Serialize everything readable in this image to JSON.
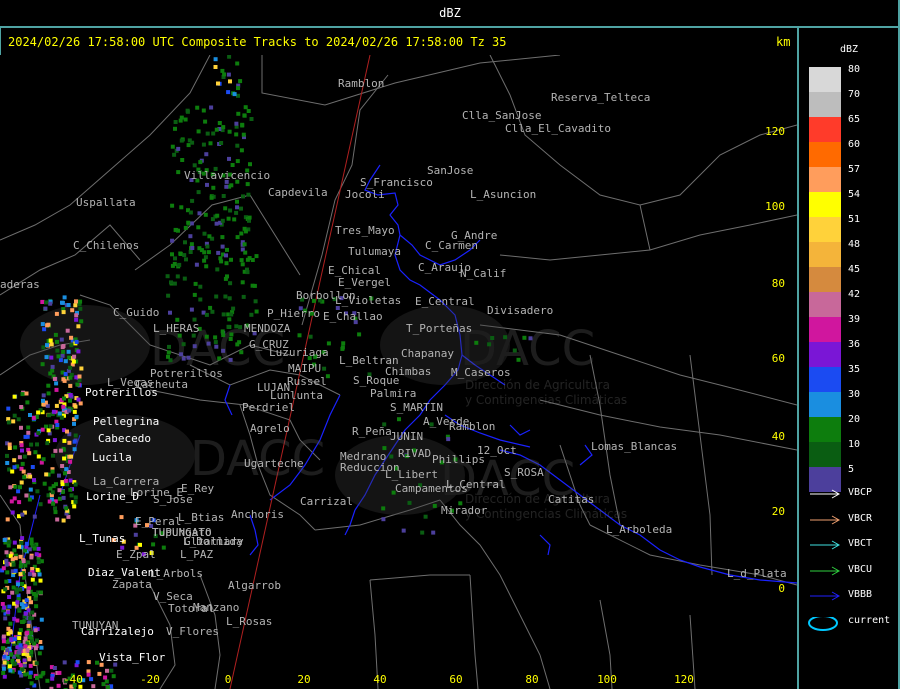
{
  "header": {
    "title": "dBZ"
  },
  "panel": {
    "title": "2024/02/26 17:58:00 UTC Composite Tracks to 2024/02/26 17:58:00 Tz 35",
    "km_label": "km",
    "x_axis_unit": "km"
  },
  "axes": {
    "x_ticks": [
      "-40",
      "-20",
      "0",
      "20",
      "40",
      "60",
      "80",
      "100",
      "120"
    ],
    "y_ticks": [
      "120",
      "100",
      "80",
      "60",
      "40",
      "20",
      "0"
    ]
  },
  "legend": {
    "title": "dBZ",
    "levels": [
      {
        "value": "80",
        "color": "#d8d8d8"
      },
      {
        "value": "70",
        "color": "#bdbdbd"
      },
      {
        "value": "65",
        "color": "#ff3b2a"
      },
      {
        "value": "60",
        "color": "#ff6a00"
      },
      {
        "value": "57",
        "color": "#ff9d5c"
      },
      {
        "value": "54",
        "color": "#ffff00"
      },
      {
        "value": "51",
        "color": "#ffd23a"
      },
      {
        "value": "48",
        "color": "#f4b43a"
      },
      {
        "value": "45",
        "color": "#d58a3e"
      },
      {
        "value": "42",
        "color": "#c8689a"
      },
      {
        "value": "39",
        "color": "#d0169e"
      },
      {
        "value": "36",
        "color": "#7a16d6"
      },
      {
        "value": "35",
        "color": "#1b4bf2"
      },
      {
        "value": "30",
        "color": "#1a8ee0"
      },
      {
        "value": "20",
        "color": "#0d7d0d"
      },
      {
        "value": "10",
        "color": "#0a5d12"
      },
      {
        "value": "5",
        "color": "#4c3f9c"
      }
    ],
    "tracks": [
      {
        "label": "VBCP",
        "color": "#ffffff"
      },
      {
        "label": "VBCR",
        "color": "#f0a070"
      },
      {
        "label": "VBCT",
        "color": "#40e0e0"
      },
      {
        "label": "VBCU",
        "color": "#30d040"
      },
      {
        "label": "VBBB",
        "color": "#2020ff"
      },
      {
        "label": "current",
        "color": "#00c8ff"
      }
    ]
  },
  "watermark": {
    "brand": "DACC",
    "line1": "Dirección de Agricultura",
    "line2": "y Contingencias Climáticas"
  },
  "places": {
    "gray": [
      "Ramblon",
      "Reserva_Telteca",
      "Clla_SanJose",
      "Clla_El_Cavadito",
      "SanJose",
      "Villavicencio",
      "Capdevila",
      "Uspallata",
      "S_Francisco",
      "Jocoli",
      "L_Asuncion",
      "C_Chilenos",
      "Tres_Mayo",
      "G_Andre",
      "C_Carmen",
      "Tulumaya",
      "E_Chical",
      "C_Araujo",
      "E_Vergel",
      "N_Calif",
      "aderas",
      "Borbollon",
      "L_Violetas",
      "E_Central",
      "Divisadero",
      "C_Guido",
      "L_HERAS",
      "P_Hierro",
      "E_Challao",
      "MENDOZA",
      "T_Porteñas",
      "G_CRUZ",
      "Luzuriaga",
      "Chapanay",
      "MAIPU",
      "L_Beltran",
      "Chimbas",
      "Potrerillos",
      "Cacheuta",
      "L_Vegas",
      "M_Caseros",
      "Russel",
      "S_Roque",
      "LUJAN",
      "Lunlunta",
      "Palmira",
      "Perdriel",
      "S_MARTIN",
      "A_Verde",
      "Agrelo",
      "R_Peña",
      "JUNIN",
      "Ramblon",
      "Lomas_Blancas",
      "Medrano",
      "RIVAD",
      "12_Oct",
      "Ugarteche",
      "Reduccion",
      "Phillips",
      "S_ROSA",
      "L_Libert",
      "L_Central",
      "La_Carrera",
      "Campamentos",
      "Lorine_E",
      "S_Jose",
      "E_Rey",
      "Carrizal",
      "Catitas",
      "Anchoris",
      "Mirador",
      "L_Btias",
      "E_Peral",
      "Tupungato",
      "TUPUNGATO",
      "L_Dormida",
      "L_Arboleda",
      "Gltallary",
      "E_Zpal",
      "L_PAZ",
      "L_d_Plata",
      "L_Arbols",
      "Zapata",
      "Algarrob",
      "V_Seca",
      "Totoral",
      "Manzano",
      "TUNUYAN",
      "L_Rosas",
      "V_Flores"
    ],
    "white": [
      "Potrerillos",
      "Pellegrina",
      "Cabecedo",
      "Lucila",
      "Lorine_D",
      "L_Tunas",
      "Diaz_Valent",
      "Carrizalejo",
      "Vista_Flor"
    ]
  }
}
